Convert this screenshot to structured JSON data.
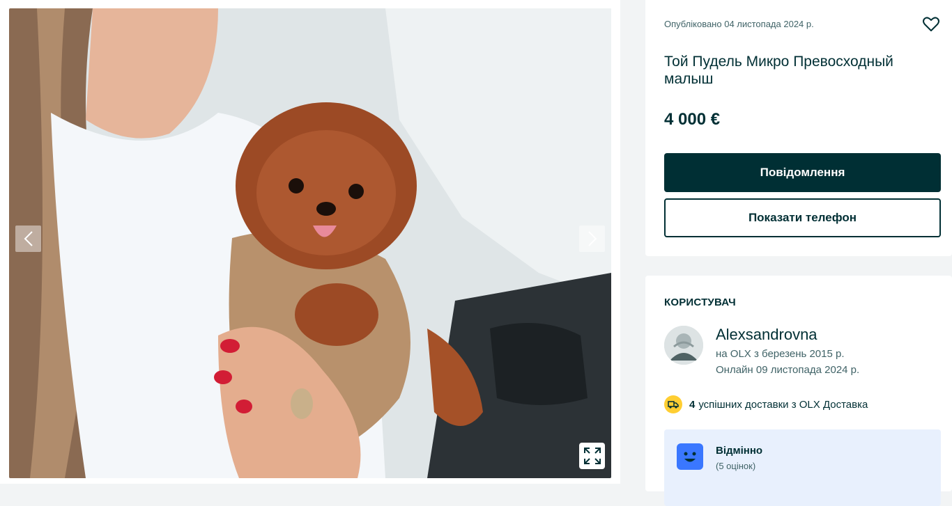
{
  "gallery": {
    "image_alt": "Той Пудель Микро Превосходный малыш",
    "prev_icon": "chevron-left-icon",
    "next_icon": "chevron-right-icon",
    "expand_icon": "expand-icon"
  },
  "offer": {
    "posted": "Опубліковано 04 листопада 2024 р.",
    "title": "Той Пудель Микро Превосходный малыш",
    "price": "4 000 €",
    "message_button": "Повідомлення",
    "phone_button": "Показати телефон",
    "favorite_icon": "heart-icon"
  },
  "user": {
    "heading": "КОРИСТУВАЧ",
    "name": "Alexsandrovna",
    "since": "на OLX з березень 2015 р.",
    "online": "Онлайн 09 листопада 2024 р.",
    "delivery_count": "4",
    "delivery_text": "успішних доставки з OLX Доставка",
    "rating_title": "Відмінно",
    "rating_count": "(5 оцінок)"
  },
  "colors": {
    "primary": "#002f34",
    "accent_yellow": "#ffce32",
    "rating_bg": "#e8f0fd",
    "rating_blue": "#3a77ff"
  }
}
